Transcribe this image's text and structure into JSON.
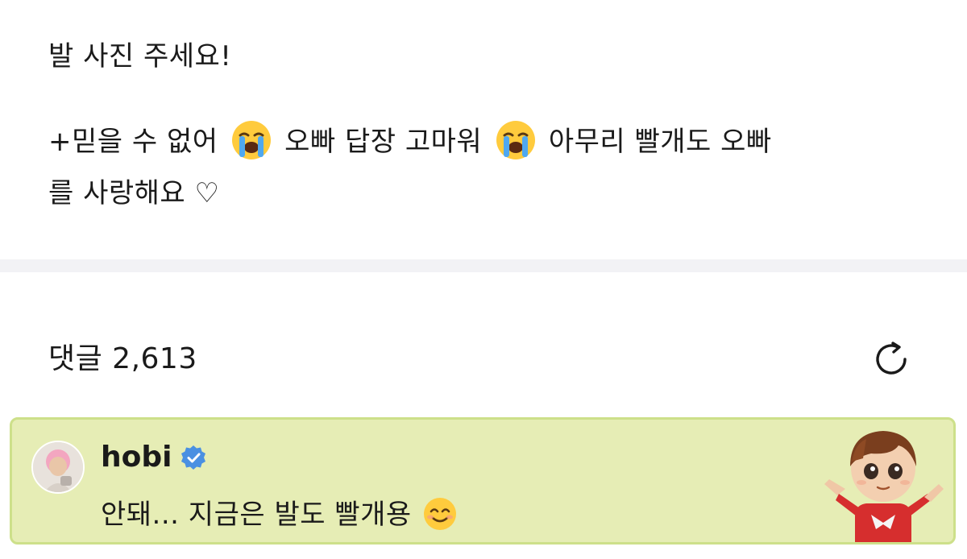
{
  "post": {
    "line1": "발 사진 주세요!",
    "line2_part1": "+믿을 수 없어",
    "line2_part2": "오빠 답장 고마워",
    "line2_part3": "아무리 빨개도 오빠",
    "line3": "를 사랑해요 ♡",
    "emoji_name": "loudly-crying-face-icon"
  },
  "comments": {
    "label": "댓글 2,613",
    "refresh_icon": "refresh-icon"
  },
  "pinned_comment": {
    "author": "hobi",
    "verified_icon": "verified-badge-icon",
    "text": "안돼... 지금은 발도 빨개용",
    "emoji_name": "smiling-face-icon",
    "background_color": "#e6edb5",
    "border_color": "#cde08a"
  },
  "colors": {
    "text": "#1a1a1a",
    "separator": "#f2f2f5",
    "verified_blue": "#4a90e2"
  }
}
